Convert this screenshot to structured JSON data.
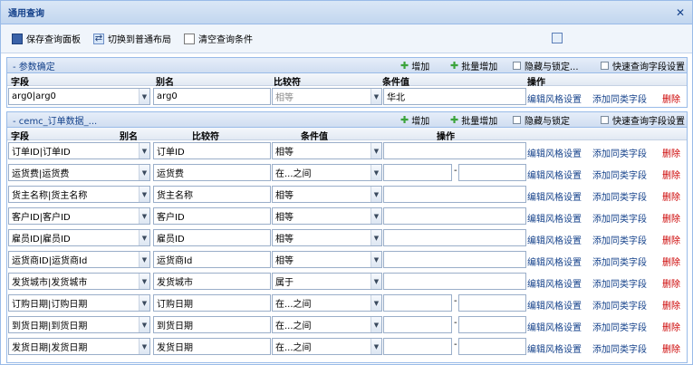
{
  "window": {
    "title": "通用查询"
  },
  "toolbar": {
    "save": "保存查询面板",
    "switch": "切换到普通布局",
    "clear": "清空查询条件"
  },
  "param_section": {
    "title": "- 参数确定",
    "add": "增加",
    "batch_add": "批量增加",
    "hide_fix": "隐藏与锁定...",
    "quick_setting": "快速查询字段设置",
    "headers": [
      "字段",
      "别名",
      "比较符",
      "条件值",
      "操作"
    ],
    "row": {
      "field": "arg0|arg0",
      "alias": "arg0",
      "op": "相等",
      "value": "华北"
    }
  },
  "main_section": {
    "title": "- cemc_订单数据_...",
    "add": "增加",
    "batch_add": "批量增加",
    "hide_fix": "隐藏与锁定",
    "quick_setting": "快速查询字段设置",
    "headers": [
      "字段",
      "别名",
      "比较符",
      "条件值",
      "操作"
    ]
  },
  "actions": {
    "edit": "编辑风格设置",
    "add_same": "添加同类字段",
    "delete": "删除"
  },
  "rows": [
    {
      "field": "订单ID|订单ID",
      "alias": "订单ID",
      "op": "相等",
      "range": false
    },
    {
      "field": "运货费|运货费",
      "alias": "运货费",
      "op": "在...之间",
      "range": true
    },
    {
      "field": "货主名称|货主名称",
      "alias": "货主名称",
      "op": "相等",
      "range": false
    },
    {
      "field": "客户ID|客户ID",
      "alias": "客户ID",
      "op": "相等",
      "range": false
    },
    {
      "field": "雇员ID|雇员ID",
      "alias": "雇员ID",
      "op": "相等",
      "range": false
    },
    {
      "field": "运货商ID|运货商Id",
      "alias": "运货商Id",
      "op": "相等",
      "range": false
    },
    {
      "field": "发货城市|发货城市",
      "alias": "发货城市",
      "op": "属于",
      "range": false
    },
    {
      "field": "订购日期|订购日期",
      "alias": "订购日期",
      "op": "在...之间",
      "range": true
    },
    {
      "field": "到货日期|到货日期",
      "alias": "到货日期",
      "op": "在...之间",
      "range": true
    },
    {
      "field": "发货日期|发货日期",
      "alias": "发货日期",
      "op": "在...之间",
      "range": true
    }
  ]
}
